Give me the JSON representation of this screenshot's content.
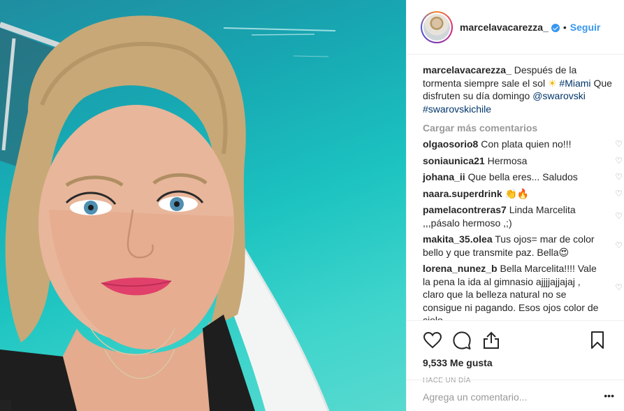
{
  "header": {
    "username": "marcelavacarezza_",
    "separator": "•",
    "follow_label": "Seguir"
  },
  "caption": {
    "username": "marcelavacarezza_",
    "text_before": "Después de la tormenta siempre sale el sol",
    "emoji": "☀",
    "hashtag": "#Miami",
    "text_after": "Que disfruten su día domingo",
    "mention": "@swarovski",
    "hashtag2": "#swarovskichile"
  },
  "load_more_label": "Cargar más comentarios",
  "comments": [
    {
      "user": "olgaosorio8",
      "text": "Con plata quien no!!!"
    },
    {
      "user": "soniaunica21",
      "text": "Hermosa"
    },
    {
      "user": "johana_ii",
      "text": "Que bella eres... Saludos"
    },
    {
      "user": "naara.superdrink",
      "text": "👏🔥"
    },
    {
      "user": "pamelacontreras7",
      "text": "Linda Marcelita ,,,pásalo hermoso ,;)"
    },
    {
      "user": "makita_35.olea",
      "text": "Tus ojos= mar de color bello y que transmite paz. Bella😍"
    },
    {
      "user": "lorena_nunez_b",
      "text": "Bella Marcelita!!!! Vale la pena la ida al gimnasio ajjjjajjajaj , claro que la belleza natural no se consigue ni pagando. Esos ojos color de cielo"
    }
  ],
  "heart_glyph": "♡",
  "likes": "9,533 Me gusta",
  "timestamp": "HACE UN DÍA",
  "add_comment_placeholder": "Agrega un comentario...",
  "more_glyph": "•••"
}
